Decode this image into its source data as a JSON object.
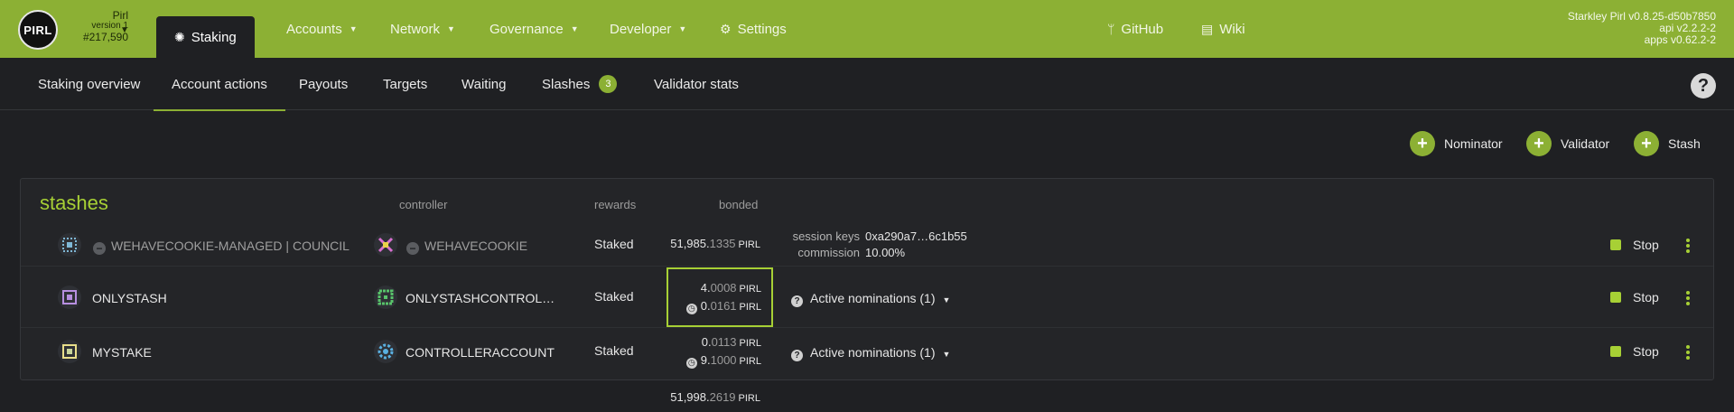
{
  "chain": {
    "logo": "PIRL",
    "name": "Pirl",
    "version": "version 1",
    "block": "#217,590"
  },
  "nav": {
    "staking": "Staking",
    "accounts": "Accounts",
    "network": "Network",
    "governance": "Governance",
    "developer": "Developer",
    "settings": "Settings",
    "github": "GitHub",
    "wiki": "Wiki"
  },
  "version_info": {
    "node": "Starkley Pirl v0.8.25-d50b7850",
    "api": "api v2.2.2-2",
    "apps": "apps v0.62.2-2"
  },
  "subtabs": {
    "overview": "Staking overview",
    "account_actions": "Account actions",
    "payouts": "Payouts",
    "targets": "Targets",
    "waiting": "Waiting",
    "slashes": "Slashes",
    "slashes_count": "3",
    "validator_stats": "Validator stats"
  },
  "help": "?",
  "actions": {
    "nominator": "Nominator",
    "validator": "Validator",
    "stash": "Stash"
  },
  "table": {
    "title": "stashes",
    "headers": {
      "controller": "controller",
      "rewards": "rewards",
      "bonded": "bonded"
    },
    "rows": [
      {
        "stash": "WEHAVECOOKIE-MANAGED | COUNCIL",
        "controller": "WEHAVECOOKIE",
        "rewards": "Staked",
        "bonded_int": "51,985.",
        "bonded_dec": "1335",
        "unit": "PIRL",
        "session_keys_label": "session keys",
        "session_keys": "0xa290a7…6c1b55",
        "commission_label": "commission",
        "commission": "10.00%",
        "stop": "Stop"
      },
      {
        "stash": "ONLYSTASH",
        "controller": "ONLYSTASHCONTROL…",
        "rewards": "Staked",
        "bonded_int": "4.",
        "bonded_dec": "0008",
        "unlock_int": "0.",
        "unlock_dec": "0161",
        "unit": "PIRL",
        "nominations": "Active nominations (1)",
        "stop": "Stop"
      },
      {
        "stash": "MYSTAKE",
        "controller": "CONTROLLERACCOUNT",
        "rewards": "Staked",
        "bonded_int": "0.",
        "bonded_dec": "0113",
        "unlock_int": "9.",
        "unlock_dec": "1000",
        "unit": "PIRL",
        "nominations": "Active nominations (1)",
        "stop": "Stop"
      }
    ],
    "total_int": "51,998.",
    "total_dec": "2619",
    "total_unit": "PIRL"
  },
  "colors": {
    "accent": "#8cb034",
    "highlight": "#a7d035",
    "background": "#1f2023"
  }
}
